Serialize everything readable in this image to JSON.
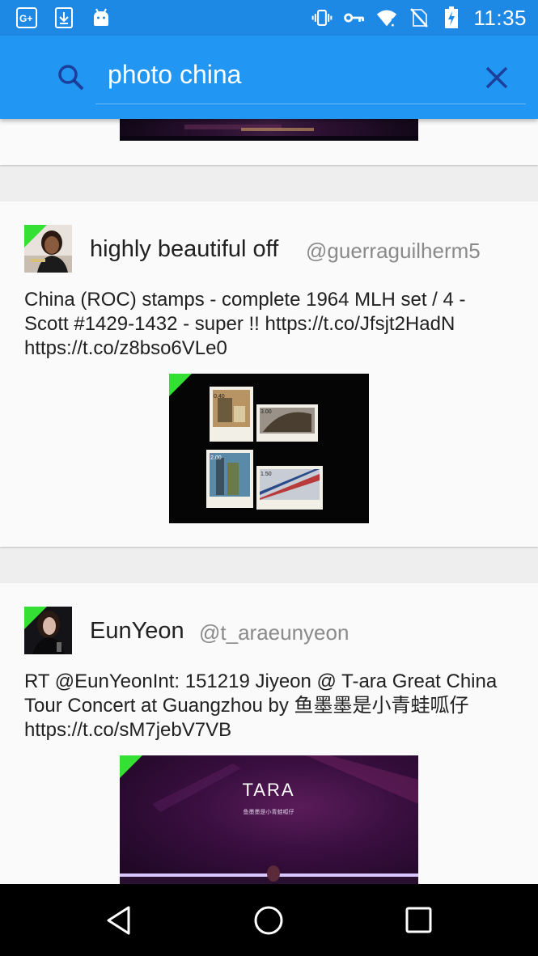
{
  "status_bar": {
    "time": "11:35",
    "left_icons": [
      "google-plus-icon",
      "download-icon",
      "android-icon"
    ],
    "right_icons": [
      "vibrate-icon",
      "vpn-key-icon",
      "wifi-icon",
      "no-sim-icon",
      "battery-charging-icon"
    ]
  },
  "search": {
    "query": "photo china",
    "icon": "search-icon",
    "clear_icon": "close-icon"
  },
  "colors": {
    "statusbar": "#1e88e5",
    "appbar": "#2196f3",
    "card": "#fafafa",
    "corner_badge": "#34e034"
  },
  "tweets": [
    {
      "user_name": "highly beautiful off",
      "handle": "@guerraguilherm5",
      "text_lines": [
        "China (ROC) stamps - complete 1964 MLH set / 4 -",
        "Scott #1429-1432 - super !! https://t.co/Jfsjt2HadN",
        "https://t.co/z8bso6VLe0"
      ],
      "stamp_values": [
        "0.40",
        "3.00",
        "2.00",
        "1.50"
      ]
    },
    {
      "user_name": "EunYeon",
      "handle": "@t_araeunyeon",
      "text_lines": [
        "RT @EunYeonInt: 151219 Jiyeon @ T-ara Great China",
        "Tour Concert at Guangzhou by 鱼墨墨是小青蛙呱仔",
        "https://t.co/sM7jebV7VB"
      ],
      "media_logo": "TARA",
      "media_caption": "鱼墨墨是小青蛙呱仔"
    }
  ],
  "nav": {
    "back": "back-icon",
    "home": "home-icon",
    "recents": "recents-icon"
  }
}
